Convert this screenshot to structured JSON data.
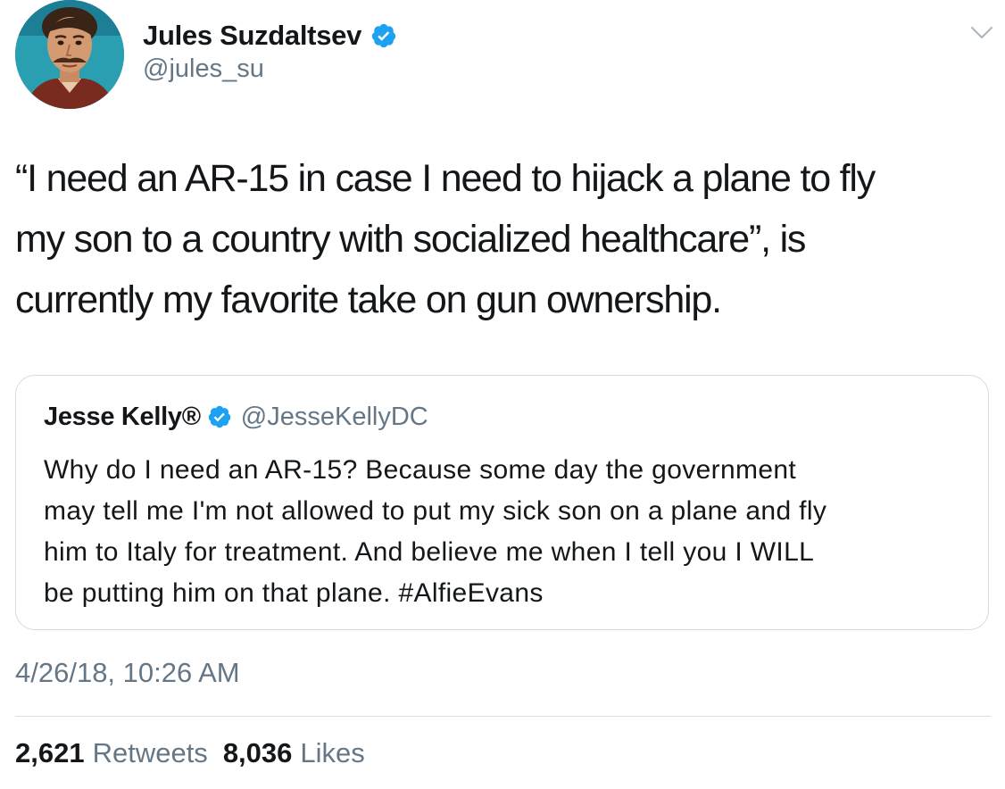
{
  "tweet": {
    "author": {
      "name": "Jules Suzdaltsev",
      "handle": "@jules_su",
      "verified": true
    },
    "text": "“I need an AR-15 in case I need to hijack a plane to fly\nmy son to a country with socialized healthcare”, is\ncurrently my favorite take on gun ownership.",
    "quoted": {
      "name": "Jesse Kelly®",
      "handle": "@JesseKellyDC",
      "verified": true,
      "text": "Why do I need an AR-15? Because some day the government\nmay tell me I'm not allowed to put my sick son on a plane and fly\nhim to Italy for treatment. And believe me when I tell you I WILL\nbe putting him on that plane. #AlfieEvans"
    },
    "timestamp": "4/26/18, 10:26 AM",
    "retweets": {
      "count": "2,621",
      "label": "Retweets"
    },
    "likes": {
      "count": "8,036",
      "label": "Likes"
    }
  },
  "colors": {
    "verified_blue": "#1da1f2",
    "secondary_text": "#657786",
    "primary_text": "#14171a"
  },
  "icons": {
    "verified": "verified-badge-icon",
    "caret": "chevron-down-icon"
  }
}
